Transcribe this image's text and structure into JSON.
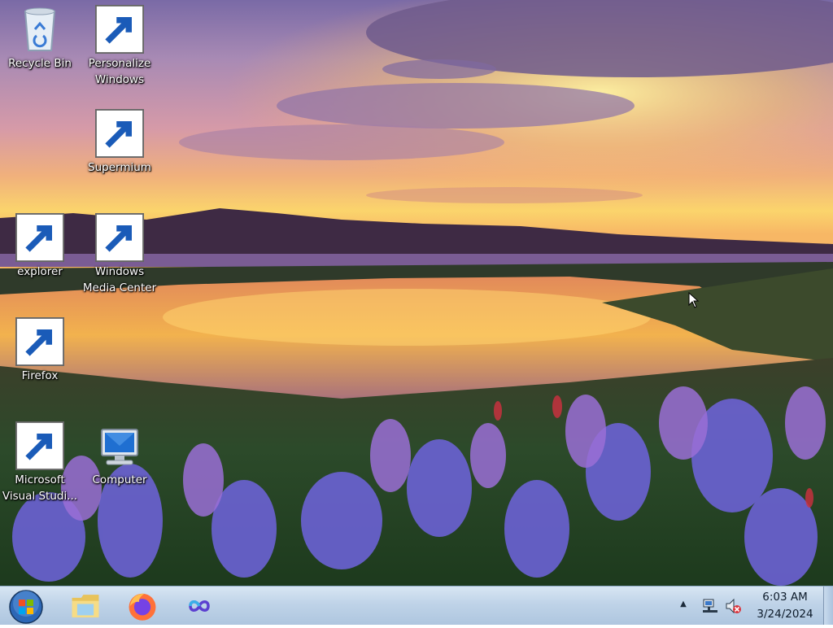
{
  "desktop": {
    "icons": [
      {
        "id": "recycle-bin",
        "label": "Recycle Bin",
        "icon": "recycle-bin-icon",
        "shortcut": false
      },
      {
        "id": "personalize",
        "label": "Personalize\nWindows",
        "icon": "personalize-icon",
        "shortcut": true
      },
      {
        "id": "supermium",
        "label": "Supermium",
        "icon": "supermium-icon",
        "shortcut": true
      },
      {
        "id": "explorer",
        "label": "explorer",
        "icon": "folder-icon",
        "shortcut": true
      },
      {
        "id": "wmc",
        "label": "Windows\nMedia Center",
        "icon": "windows-media-center-icon",
        "shortcut": true
      },
      {
        "id": "firefox",
        "label": "Firefox",
        "icon": "firefox-icon",
        "shortcut": true
      },
      {
        "id": "vs",
        "label": "Microsoft\nVisual Studi...",
        "icon": "visual-studio-icon",
        "shortcut": true
      },
      {
        "id": "computer",
        "label": "Computer",
        "icon": "computer-icon",
        "shortcut": false
      }
    ]
  },
  "taskbar": {
    "start": {
      "icon": "windows-start-orb-icon"
    },
    "pinned": [
      {
        "id": "explorer",
        "icon": "folder-icon"
      },
      {
        "id": "firefox",
        "icon": "firefox-icon"
      },
      {
        "id": "visual-studio",
        "icon": "visual-studio-icon"
      }
    ],
    "tray": {
      "overflow_glyph": "▲",
      "icons": [
        "network-icon",
        "volume-muted-icon"
      ]
    },
    "clock": {
      "time": "6:03 AM",
      "date": "3/24/2024"
    }
  },
  "colors": {
    "taskbar": "#bfd3e8",
    "label_text": "#ffffff"
  }
}
